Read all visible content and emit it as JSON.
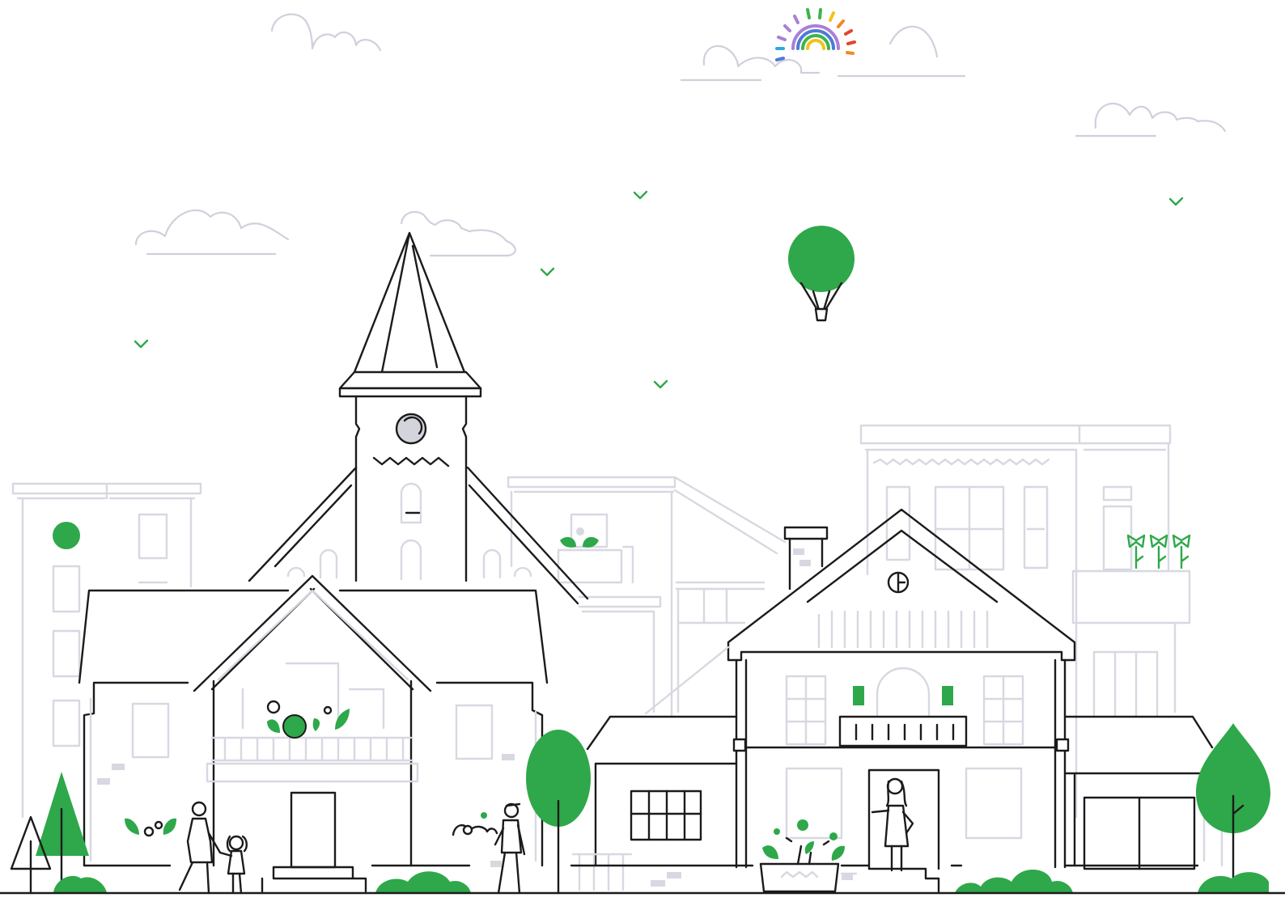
{
  "scene": {
    "colors": {
      "accent_green": "#2ea84a",
      "outline": "#1b1b1b",
      "background_buildings": "#d8d8e2",
      "clouds": "#d0d0dc",
      "sun_rays": [
        "#a97fd8",
        "#4b7bd6",
        "#2fa8e0",
        "#3cb44a",
        "#f2c21b",
        "#f08a24",
        "#e2452f"
      ]
    },
    "icons": [
      "rainbow-sun-icon",
      "hot-air-balloon-icon",
      "clock-icon",
      "tulip-icon",
      "bird-icon",
      "tree-icon",
      "bush-icon"
    ]
  }
}
